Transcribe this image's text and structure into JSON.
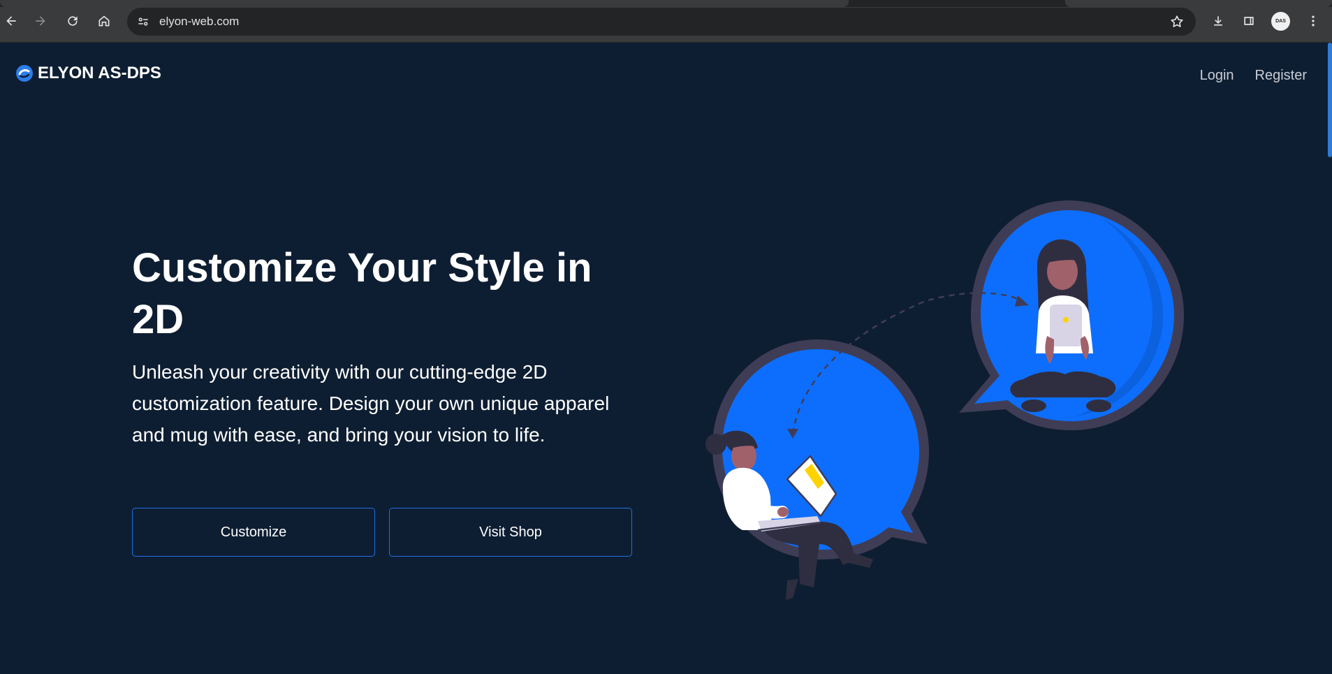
{
  "browser": {
    "url": "elyon-web.com",
    "avatar_text": "DAS"
  },
  "header": {
    "brand": "ELYON AS-DPS",
    "login": "Login",
    "register": "Register"
  },
  "hero": {
    "title": "Customize Your Style in 2D",
    "subtitle": "Unleash your creativity with our cutting-edge 2D customization feature. Design your own unique apparel and mug with ease, and bring your vision to life.",
    "customize_button": "Customize",
    "shop_button": "Visit Shop"
  },
  "colors": {
    "page_bg": "#0e1e32",
    "accent": "#1f6fe6",
    "bubble": "#0d6efd",
    "bubble_outline": "#3f3d56"
  }
}
